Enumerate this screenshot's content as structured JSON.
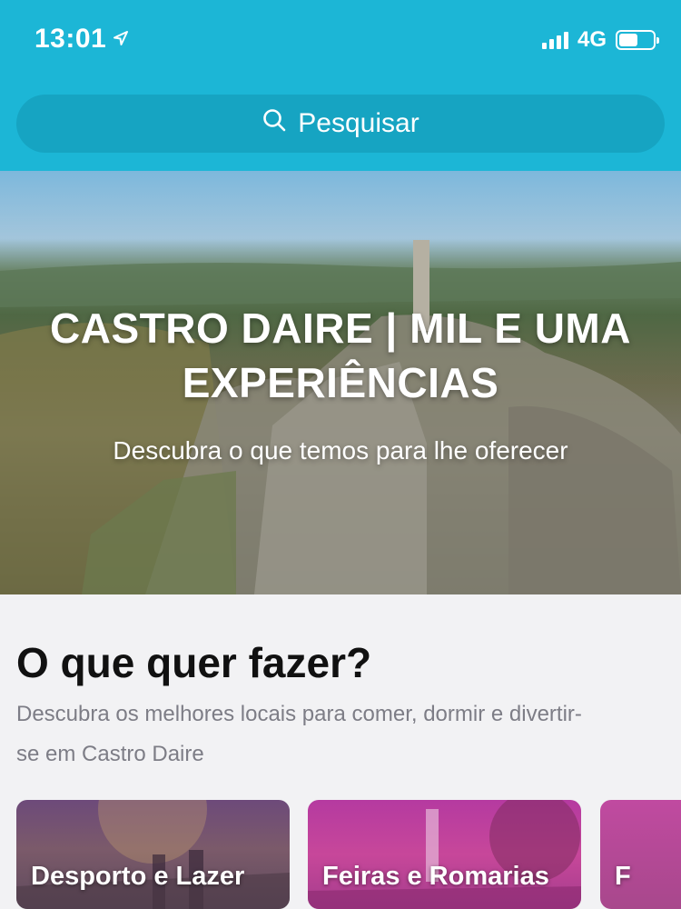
{
  "status_bar": {
    "time": "13:01",
    "network": "4G",
    "battery_level": 0.55
  },
  "search": {
    "placeholder": "Pesquisar"
  },
  "hero": {
    "title": "CASTRO DAIRE | MIL E UMA EXPERIÊNCIAS",
    "subtitle": "Descubra o que temos para lhe oferecer"
  },
  "section": {
    "title": "O que quer fazer?",
    "description": "Descubra os melhores locais para comer, dormir e divertir-se em Castro Daire"
  },
  "categories": [
    {
      "label": "Desporto e Lazer"
    },
    {
      "label": "Feiras e Romarias"
    },
    {
      "label": "F"
    }
  ],
  "colors": {
    "header": "#1cb6d6",
    "search_bar": "#16a4c2"
  }
}
